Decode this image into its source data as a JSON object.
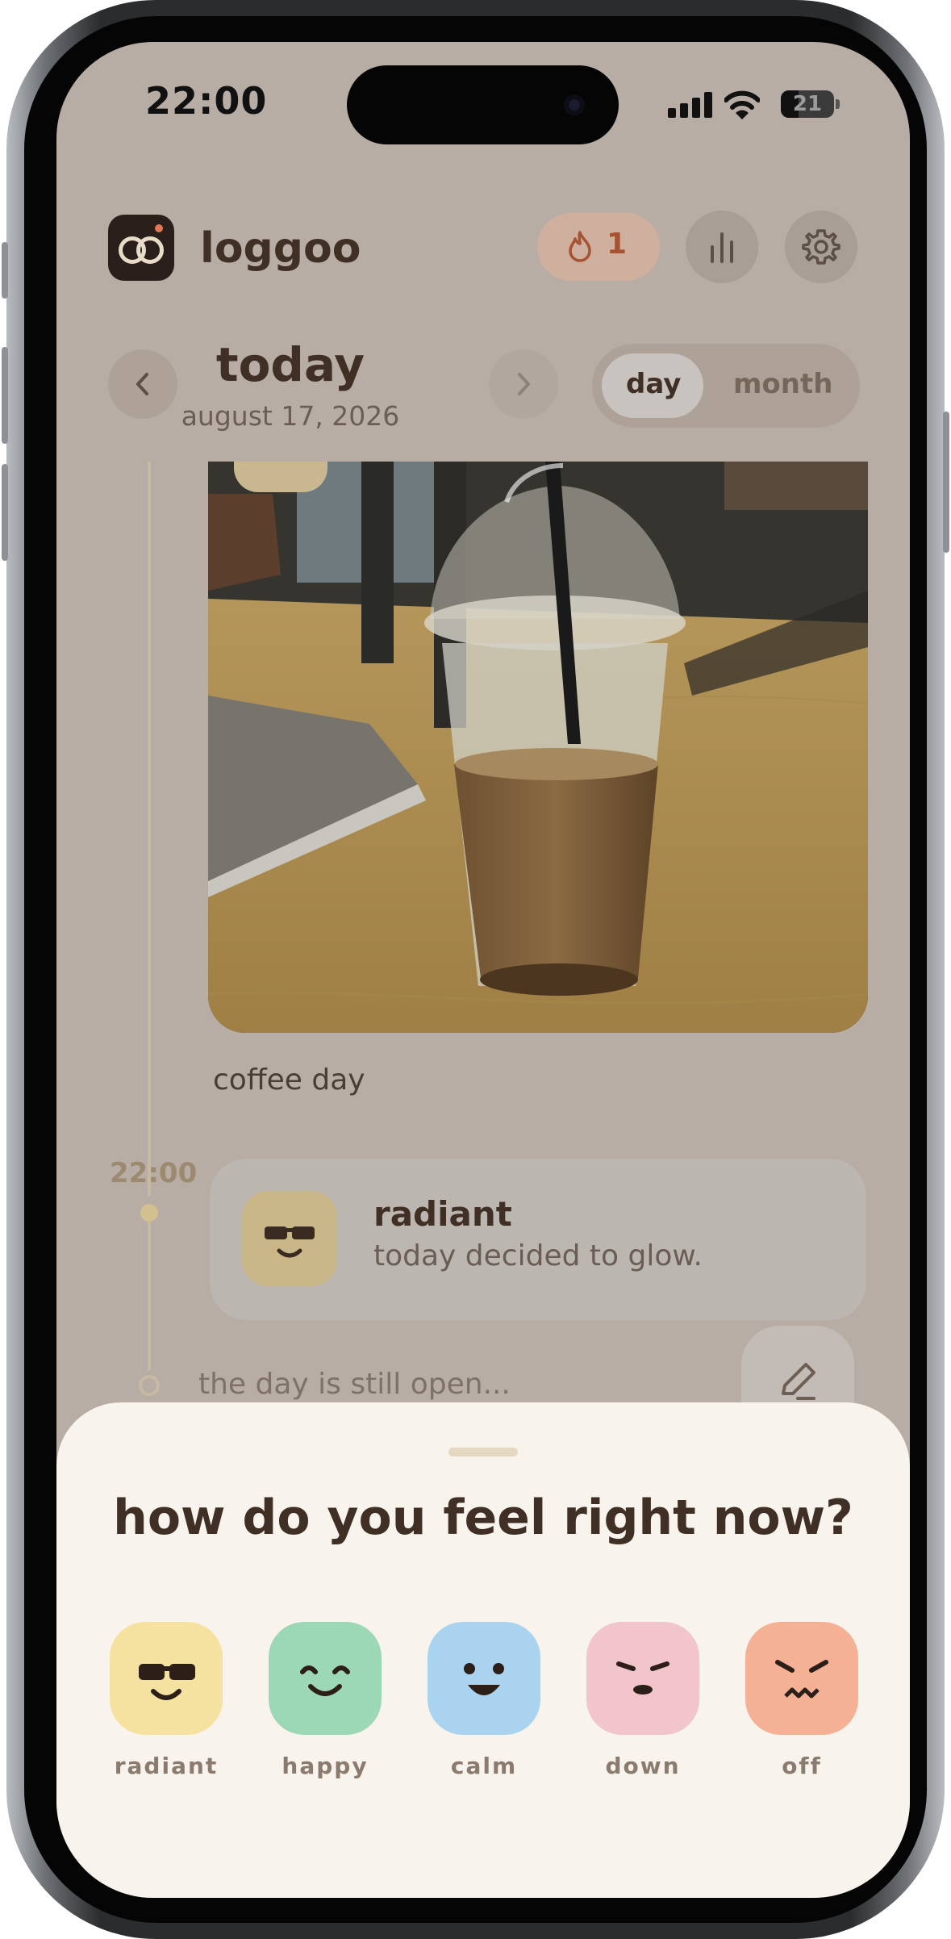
{
  "status_bar": {
    "time": "22:00",
    "battery": "21"
  },
  "header": {
    "app_name": "loggoo",
    "streak_count": "1",
    "stats_icon": "bar-chart-icon",
    "settings_icon": "gear-icon"
  },
  "date_nav": {
    "title": "today",
    "date": "august 17, 2026",
    "view_toggle": [
      "day",
      "month"
    ],
    "selected_view": "day"
  },
  "timeline": {
    "photo_caption": "coffee day",
    "entry": {
      "time": "22:00",
      "mood": "radiant",
      "note": "today decided to glow."
    },
    "open_text": "the day is still open..."
  },
  "sheet": {
    "question": "how do you feel right now?",
    "moods": [
      {
        "label": "radiant",
        "color": "#f6e2a0"
      },
      {
        "label": "happy",
        "color": "#9cd8b6"
      },
      {
        "label": "calm",
        "color": "#a9d3ee"
      },
      {
        "label": "down",
        "color": "#f2c4cb"
      },
      {
        "label": "off",
        "color": "#f5b196"
      }
    ]
  },
  "colors": {
    "background_overlay": "#b8ada5",
    "sheet": "#f8f3ec",
    "text_primary": "#3f2f25",
    "accent_orange": "#a55332"
  }
}
